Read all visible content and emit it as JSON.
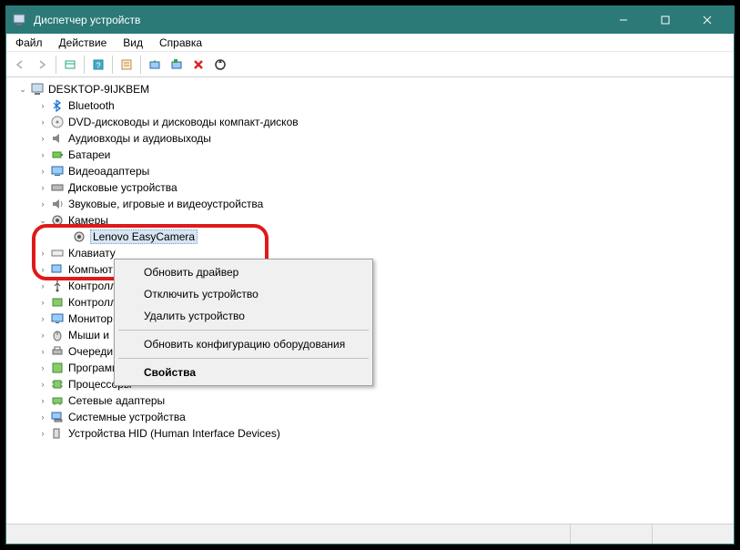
{
  "window": {
    "title": "Диспетчер устройств"
  },
  "menu": {
    "file": "Файл",
    "action": "Действие",
    "view": "Вид",
    "help": "Справка"
  },
  "tree": {
    "root": "DESKTOP-9IJKBEM",
    "bluetooth": "Bluetooth",
    "dvd": "DVD-дисководы и дисководы компакт-дисков",
    "audio": "Аудиовходы и аудиовыходы",
    "batteries": "Батареи",
    "video": "Видеоадаптеры",
    "disk": "Дисковые устройства",
    "sound": "Звуковые, игровые и видеоустройства",
    "cameras": "Камеры",
    "camera_device": "Lenovo EasyCamera",
    "keyboards": "Клавиату",
    "computer": "Компьют",
    "usb": "Контролл",
    "storage": "Контролл",
    "monitors": "Монитор",
    "mice": "Мыши и",
    "printq": "Очереди печати",
    "software": "Программные устройства",
    "cpu": "Процессоры",
    "network": "Сетевые адаптеры",
    "system": "Системные устройства",
    "hid": "Устройства HID (Human Interface Devices)"
  },
  "context": {
    "update_driver": "Обновить драйвер",
    "disable": "Отключить устройство",
    "uninstall": "Удалить устройство",
    "scan": "Обновить конфигурацию оборудования",
    "properties": "Свойства"
  }
}
